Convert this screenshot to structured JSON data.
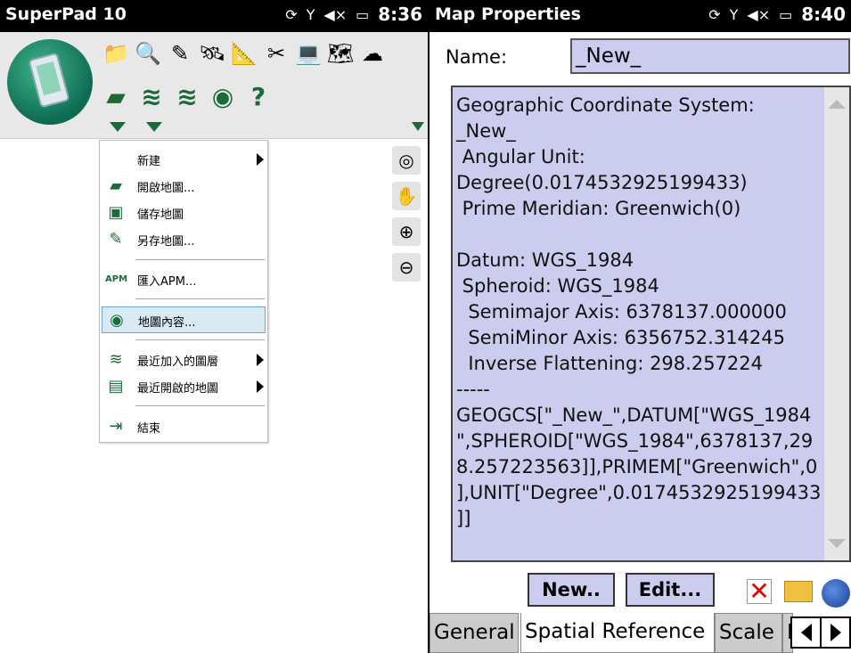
{
  "left": {
    "status": {
      "title": "SuperPad 10",
      "time": "8:36"
    },
    "menu": {
      "items": [
        {
          "label": "新建",
          "icon": "new-icon",
          "submenu": true
        },
        {
          "label": "開啟地圖...",
          "icon": "open-folder-icon",
          "submenu": false
        },
        {
          "label": "儲存地圖",
          "icon": "save-icon",
          "submenu": false
        },
        {
          "label": "另存地圖...",
          "icon": "save-as-icon",
          "submenu": false
        },
        {
          "label": "匯入APM...",
          "icon": "apm-import-icon",
          "submenu": false
        },
        {
          "label": "地圖內容...",
          "icon": "map-properties-icon",
          "submenu": false
        },
        {
          "label": "最近加入的圖層",
          "icon": "recent-layers-icon",
          "submenu": true
        },
        {
          "label": "最近開啟的地圖",
          "icon": "recent-maps-icon",
          "submenu": true
        },
        {
          "label": "結束",
          "icon": "exit-icon",
          "submenu": false
        }
      ]
    }
  },
  "right": {
    "status": {
      "title": "Map Properties",
      "time": "8:40"
    },
    "name_label": "Name:",
    "name_value": "_New_",
    "coord_text": "Geographic Coordinate System:\n_New_\n Angular Unit:\nDegree(0.0174532925199433)\n Prime Meridian: Greenwich(0)\n\nDatum: WGS_1984\n Spheroid: WGS_1984\n  Semimajor Axis: 6378137.000000\n  SemiMinor Axis: 6356752.314245\n  Inverse Flattening: 298.257224\n-----\nGEOGCS[\"_New_\",DATUM[\"WGS_1984\n\",SPHEROID[\"WGS_1984\",6378137,29\n8.257223563]],PRIMEM[\"Greenwich\",0\n],UNIT[\"Degree\",0.0174532925199433\n]]",
    "buttons": {
      "new": "New..",
      "edit": "Edit..."
    },
    "tabs": [
      "General",
      "Spatial Reference",
      "Scale",
      "I"
    ]
  }
}
